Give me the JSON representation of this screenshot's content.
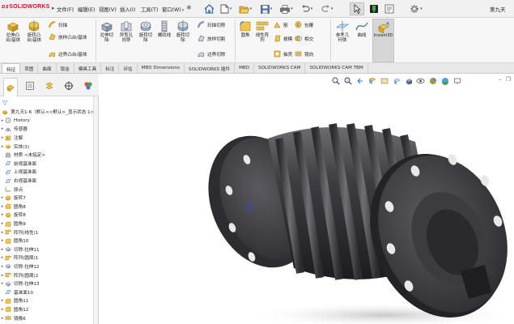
{
  "app": {
    "logo_text": "SOLIDWORKS",
    "document_title": "第九天"
  },
  "menu": [
    {
      "label": "文件(F)"
    },
    {
      "label": "编辑(E)"
    },
    {
      "label": "视图(V)"
    },
    {
      "label": "插入(I)"
    },
    {
      "label": "工具(T)"
    },
    {
      "label": "窗口(W)"
    }
  ],
  "toolbar_icons": [
    "home-icon",
    "new-file-icon",
    "open-folder-icon",
    "save-icon",
    "print-icon",
    "undo-icon",
    "redo-icon",
    "select-arrow-icon",
    "rebuild-icon",
    "options-gear-icon"
  ],
  "ribbon": {
    "big_buttons": [
      {
        "label": "拉伸凸\n台/基体"
      },
      {
        "label": "旋转凸\n台/基体"
      },
      {
        "label": "拉伸切\n除"
      },
      {
        "label": "异型孔\n向导"
      },
      {
        "label": "旋转切\n除"
      },
      {
        "label": "螺纹线"
      },
      {
        "label": "旋转切\n除"
      },
      {
        "label": "圆角"
      },
      {
        "label": "线性阵\n列"
      },
      {
        "label": "参考几\n何体"
      },
      {
        "label": "曲线"
      },
      {
        "label": "Instant3D"
      }
    ],
    "small_buttons": [
      {
        "label": "扫描"
      },
      {
        "label": "放样凸台/基体"
      },
      {
        "label": "边界凸台/基体"
      },
      {
        "label": "扫描切除"
      },
      {
        "label": "放样切割"
      },
      {
        "label": "边界切除"
      },
      {
        "label": "筋"
      },
      {
        "label": "拔模"
      },
      {
        "label": "抽壳"
      },
      {
        "label": "包覆"
      },
      {
        "label": "相交"
      },
      {
        "label": "镜向"
      }
    ]
  },
  "tabs": [
    {
      "label": "特征",
      "active": true
    },
    {
      "label": "草图"
    },
    {
      "label": "曲面"
    },
    {
      "label": "钣金"
    },
    {
      "label": "模具工具"
    },
    {
      "label": "标注"
    },
    {
      "label": "评估"
    },
    {
      "label": "MBD Dimensions"
    },
    {
      "label": "SOLIDWORKS 插件"
    },
    {
      "label": "MBD"
    },
    {
      "label": "SOLIDWORKS CAM"
    },
    {
      "label": "SOLIDWORKS CAM TBM"
    }
  ],
  "feature_tree": {
    "root": "第九天1-6（默认<<默认>_显示状态 1>）",
    "items": [
      {
        "label": "History",
        "icon": "history"
      },
      {
        "label": "传感器",
        "icon": "sensor"
      },
      {
        "label": "注解",
        "icon": "annotation"
      },
      {
        "label": "实体(1)",
        "icon": "solid"
      },
      {
        "label": "材质 <未指定>",
        "icon": "material"
      },
      {
        "label": "前视基准面",
        "icon": "plane"
      },
      {
        "label": "上视基准面",
        "icon": "plane"
      },
      {
        "label": "右视基准面",
        "icon": "plane"
      },
      {
        "label": "原点",
        "icon": "origin"
      },
      {
        "label": "旋转7",
        "icon": "revolve"
      },
      {
        "label": "圆角8",
        "icon": "fillet"
      },
      {
        "label": "旋转8",
        "icon": "revolve"
      },
      {
        "label": "圆角9",
        "icon": "fillet"
      },
      {
        "label": "阵列(线性)1",
        "icon": "pattern"
      },
      {
        "label": "圆角10",
        "icon": "fillet"
      },
      {
        "label": "切除-拉伸11",
        "icon": "cut"
      },
      {
        "label": "阵列(圆周)1",
        "icon": "pattern"
      },
      {
        "label": "切除-拉伸12",
        "icon": "cut"
      },
      {
        "label": "阵列(圆周)2",
        "icon": "pattern"
      },
      {
        "label": "切除-拉伸13",
        "icon": "cut"
      },
      {
        "label": "基准面10",
        "icon": "plane"
      },
      {
        "label": "圆角11",
        "icon": "fillet"
      },
      {
        "label": "圆角12",
        "icon": "fillet"
      },
      {
        "label": "镜像6",
        "icon": "mirror"
      }
    ]
  },
  "colors": {
    "accent": "#2a74c9",
    "brand": "#c8102e",
    "model_dark": "#3a3a3e"
  }
}
